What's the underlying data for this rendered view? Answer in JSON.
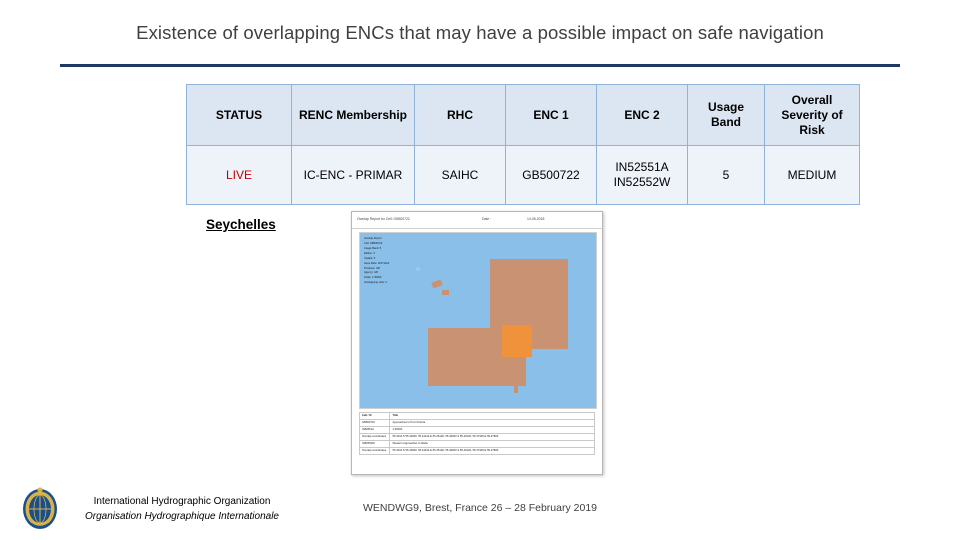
{
  "slide": {
    "title": "Existence of overlapping ENCs that may have a possible impact on safe navigation",
    "country_label": "Seychelles"
  },
  "table": {
    "headers": [
      "STATUS",
      "RENC Membership",
      "RHC",
      "ENC 1",
      "ENC 2",
      "Usage Band",
      "Overall Severity of Risk"
    ],
    "rows": [
      {
        "status": "LIVE",
        "renc_membership": "IC-ENC - PRIMAR",
        "rhc": "SAIHC",
        "enc1": "GB500722",
        "enc2_line1": "IN52551A",
        "enc2_line2": "IN52552W",
        "usage_band": "5",
        "overall_severity": "MEDIUM"
      }
    ]
  },
  "screenshot": {
    "header_left": "Overlap Report for Cell: GB500722",
    "header_center": "Date :",
    "header_right": "14-05-2018",
    "map_legend": [
      "Overlap Report",
      "Cell: GB500722",
      "Usage Band: 5",
      "Edition: 3",
      "Update: 0",
      "Issue Date: 20171124",
      "Producer: GB",
      "Agency: GB",
      "Scale: 1:45000",
      "Overlapping cells: 2"
    ],
    "detail_table": {
      "headers": [
        "Cell / IC",
        "Title"
      ],
      "rows": [
        {
          "c1": "GB500722",
          "c2": "Approaches to Port Victoria"
        },
        {
          "c1": "IN52551A",
          "c2": "1:45000"
        },
        {
          "c1": "Overlap coordinates",
          "c2": "55.4331 S 55.43900, 55.44444 E 55.45100, 55.46000 S 55.46120, 55.47300 E 55.47800"
        },
        {
          "c1": "IN52552W",
          "c2": "Western Approaches to Mahe"
        },
        {
          "c1": "Overlap coordinates",
          "c2": "55.4331 S 55.43900, 55.44444 E 55.45100, 55.46000 S 55.46120, 55.47300 E 55.47800"
        }
      ]
    }
  },
  "footer": {
    "org_line1": "International Hydrographic Organization",
    "org_line2": "Organisation Hydrographique Internationale",
    "event": "WENDWG9, Brest, France 26 – 28 February 2019"
  },
  "colors": {
    "title_text": "#404040",
    "rule": "#1f3864",
    "table_header_bg": "#dce6f2",
    "table_row_bg": "#eef3fa",
    "table_border": "#8fb3d9",
    "live_text": "#c00000",
    "sea": "#89bfe8",
    "land": "#c89273",
    "highlight_cell": "#f0923c"
  }
}
